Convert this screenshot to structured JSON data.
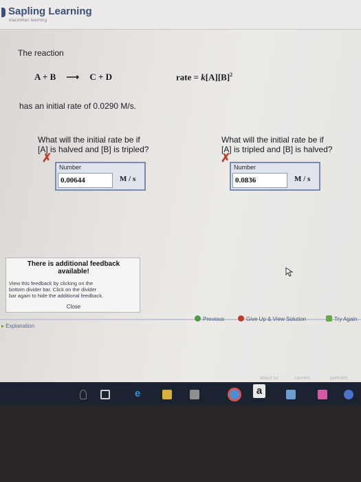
{
  "header": {
    "title": "Sapling Learning",
    "subtitle": "macmillan learning"
  },
  "problem": {
    "intro": "The reaction",
    "reaction_left": "A + B",
    "arrow": "⟶",
    "reaction_right": "C + D",
    "rate_prefix": "rate = ",
    "rate_k": "k",
    "rate_A": "[A]",
    "rate_B": "[B]",
    "rate_exp": "2",
    "initial_rate_text": "has an initial rate of 0.0290 M/s."
  },
  "questions": [
    {
      "text_line1": "What will the initial rate be if",
      "text_line2": "[A] is halved and [B] is tripled?",
      "number_label": "Number",
      "value": "0.00644",
      "unit": "M / s",
      "status": "incorrect"
    },
    {
      "text_line1": "What will the initial rate be if",
      "text_line2": "[A] is tripled and [B] is halved?",
      "number_label": "Number",
      "value": "0.0836",
      "unit": "M / s",
      "status": "incorrect"
    }
  ],
  "feedback": {
    "title_line1": "There is additional feedback",
    "title_line2": "available!",
    "line1": "View this feedback by clicking on the",
    "line2": "bottom divider bar. Click on the divider",
    "line3": "bar again to hide the additional feedback.",
    "close": "Close"
  },
  "nav": {
    "previous": "Previous",
    "give_up": "Give Up & View Solution",
    "try_again": "Try Again",
    "explanation": "Explanation"
  },
  "footer": {
    "links": [
      "about us",
      "careers",
      "partners"
    ]
  },
  "taskbar": {
    "icons": [
      "search-icon",
      "task-view-icon",
      "edge-icon",
      "file-explorer-icon",
      "store-icon",
      "chrome-icon",
      "amazon-icon",
      "photos-icon",
      "app-icon"
    ],
    "amazon_label": "a"
  },
  "colors": {
    "brand": "#3c4f79",
    "error": "#c0392b",
    "answer_box_border": "#7a8aa8",
    "taskbar": "#1b2330"
  }
}
